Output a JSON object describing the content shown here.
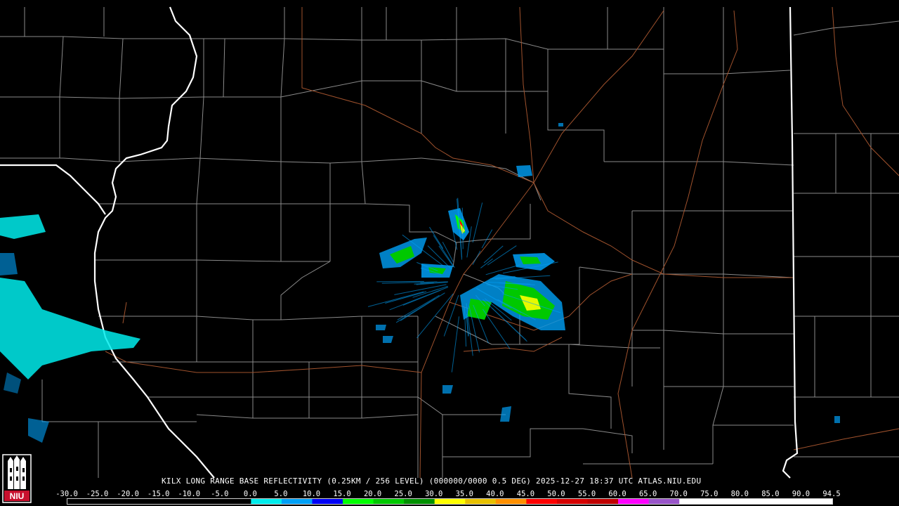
{
  "product": {
    "title_line": "KILX LONG RANGE BASE REFLECTIVITY (0.25KM / 256 LEVEL) (000000/0000 0.5 DEG) 2025-12-27 18:37 UTC  ATLAS.NIU.EDU"
  },
  "scale": {
    "labels": [
      "-30.0",
      "-25.0",
      "-20.0",
      "-15.0",
      "-10.0",
      "-5.0",
      "0.0",
      "5.0",
      "10.0",
      "15.0",
      "20.0",
      "25.0",
      "30.0",
      "35.0",
      "40.0",
      "45.0",
      "50.0",
      "55.0",
      "60.0",
      "65.0",
      "70.0",
      "75.0",
      "80.0",
      "85.0",
      "90.0",
      "94.5"
    ],
    "colors": [
      "#000000",
      "#000000",
      "#000000",
      "#000000",
      "#000000",
      "#000000",
      "#00ecec",
      "#00a0f6",
      "#0000f6",
      "#00ff00",
      "#00c800",
      "#009000",
      "#ffff00",
      "#e7c000",
      "#ff9000",
      "#ff0000",
      "#d60000",
      "#c00000",
      "#ff00ff",
      "#9955c9",
      "#ffffff",
      "#ffffff",
      "#ffffff",
      "#ffffff",
      "#ffffff"
    ]
  },
  "logo": {
    "text": "NIU",
    "colors": {
      "red": "#c8102e",
      "black": "#000000",
      "white": "#ffffff"
    }
  },
  "map_colors": {
    "county_lines": "#8a8a8a",
    "state_lines": "#ffffff",
    "highways": "#a0522d"
  },
  "radar": {
    "site": "KILX"
  }
}
